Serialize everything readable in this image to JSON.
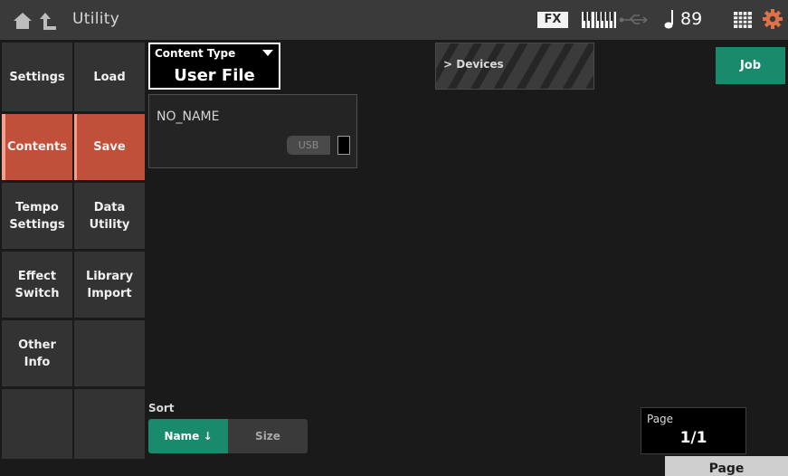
{
  "topbar": {
    "title": "Utility",
    "fx_label": "FX",
    "tempo": "89",
    "icons": [
      "home-icon",
      "up-arrow-icon",
      "keyboard-icon",
      "usb-cable-icon",
      "note-icon",
      "grid-icon",
      "gear-icon"
    ]
  },
  "sidebar": {
    "col1": [
      {
        "label": "Settings",
        "active": false
      },
      {
        "label": "Contents",
        "active": true
      },
      {
        "label": "Tempo\nSettings",
        "active": false
      },
      {
        "label": "Effect\nSwitch",
        "active": false
      },
      {
        "label": "Other\nInfo",
        "active": false
      },
      {
        "label": "",
        "active": false
      }
    ],
    "col2": [
      {
        "label": "Load",
        "active": false
      },
      {
        "label": "Save",
        "active": true
      },
      {
        "label": "Data\nUtility",
        "active": false
      },
      {
        "label": "Library\nImport",
        "active": false
      },
      {
        "label": "",
        "active": false
      },
      {
        "label": "",
        "active": false
      }
    ]
  },
  "content_type": {
    "label": "Content Type",
    "value": "User File"
  },
  "devices": {
    "label": "> Devices"
  },
  "job": {
    "label": "Job"
  },
  "device_card": {
    "name": "NO_NAME",
    "usb_label": "USB"
  },
  "sort": {
    "label": "Sort",
    "options": [
      {
        "label": "Name ↓",
        "selected": true
      },
      {
        "label": "Size",
        "selected": false
      }
    ]
  },
  "page": {
    "label": "Page",
    "value": "1/1"
  },
  "page_button": {
    "label": "Page"
  },
  "colors": {
    "accent_active": "#c0503a",
    "accent_green": "#1a8a6c",
    "background": "#1a1a1a",
    "topbar": "#3a3a3a"
  }
}
